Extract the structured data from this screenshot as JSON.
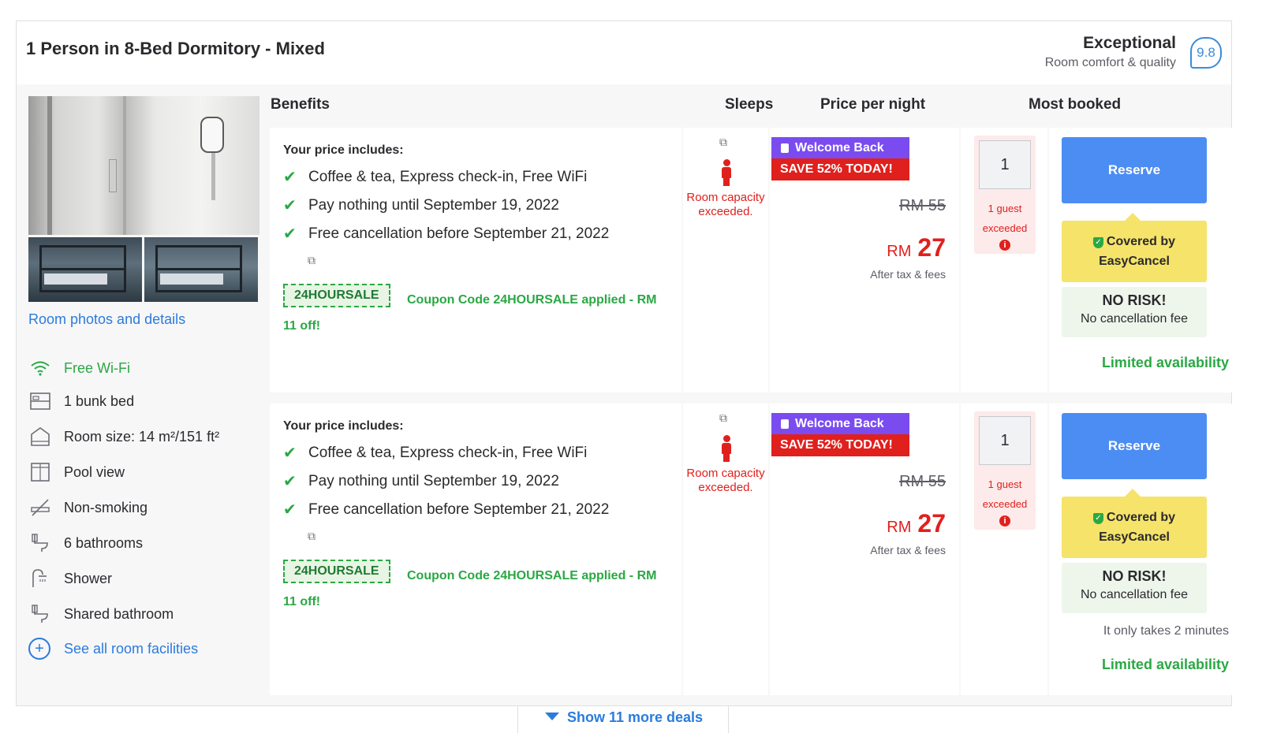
{
  "room": {
    "title": "1 Person in 8-Bed Dormitory - Mixed",
    "rating_word": "Exceptional",
    "rating_sub": "Room comfort & quality",
    "score": "9.8"
  },
  "side": {
    "photos_link": "Room photos and details",
    "facilities": [
      {
        "icon": "wifi-icon",
        "label": "Free Wi-Fi"
      },
      {
        "icon": "bunk-bed-icon",
        "label": "1 bunk bed"
      },
      {
        "icon": "room-size-icon",
        "label": "Room size: 14 m²/151 ft²"
      },
      {
        "icon": "pool-view-icon",
        "label": "Pool view"
      },
      {
        "icon": "non-smoking-icon",
        "label": "Non-smoking"
      },
      {
        "icon": "bathroom-icon",
        "label": "6 bathrooms"
      },
      {
        "icon": "shower-icon",
        "label": "Shower"
      },
      {
        "icon": "shared-bathroom-icon",
        "label": "Shared bathroom"
      }
    ],
    "see_all": "See all room facilities"
  },
  "columns": {
    "benefits": "Benefits",
    "sleeps": "Sleeps",
    "price": "Price per night",
    "most_booked": "Most booked"
  },
  "deals": [
    {
      "includes_title": "Your price includes:",
      "benefits": [
        "Coffee & tea, Express check-in, Free WiFi",
        "Pay nothing until September 19, 2022",
        "Free cancellation before September 21, 2022"
      ],
      "coupon_code": "24HOURSALE",
      "coupon_text": "Coupon Code 24HOURSALE applied - RM 11 off!",
      "capacity_msg": "Room capacity exceeded.",
      "welcome": "Welcome Back",
      "save": "SAVE 52% TODAY!",
      "old_price": "RM 55",
      "currency": "RM",
      "price": "27",
      "tax_note": "After tax & fees",
      "qty": "1",
      "guest_warn_1": "1 guest",
      "guest_warn_2": "exceeded",
      "reserve": "Reserve",
      "covered_1": "Covered by",
      "covered_2": "EasyCancel",
      "no_risk": "NO RISK!",
      "no_fee": "No cancellation fee",
      "takes": "",
      "limited": "Limited availability"
    },
    {
      "includes_title": "Your price includes:",
      "benefits": [
        "Coffee & tea, Express check-in, Free WiFi",
        "Pay nothing until September 19, 2022",
        "Free cancellation before September 21, 2022"
      ],
      "coupon_code": "24HOURSALE",
      "coupon_text": "Coupon Code 24HOURSALE applied - RM 11 off!",
      "capacity_msg": "Room capacity exceeded.",
      "welcome": "Welcome Back",
      "save": "SAVE 52% TODAY!",
      "old_price": "RM 55",
      "currency": "RM",
      "price": "27",
      "tax_note": "After tax & fees",
      "qty": "1",
      "guest_warn_1": "1 guest",
      "guest_warn_2": "exceeded",
      "reserve": "Reserve",
      "covered_1": "Covered by",
      "covered_2": "EasyCancel",
      "no_risk": "NO RISK!",
      "no_fee": "No cancellation fee",
      "takes": "It only takes 2 minutes",
      "limited": "Limited availability"
    }
  ],
  "more_deals": "Show 11 more deals",
  "colors": {
    "accent_blue": "#4c8df3",
    "link_blue": "#2b7bdc",
    "green": "#2aa844",
    "red": "#e0201d",
    "purple": "#7a4cf0",
    "yellow": "#f6e36a"
  }
}
